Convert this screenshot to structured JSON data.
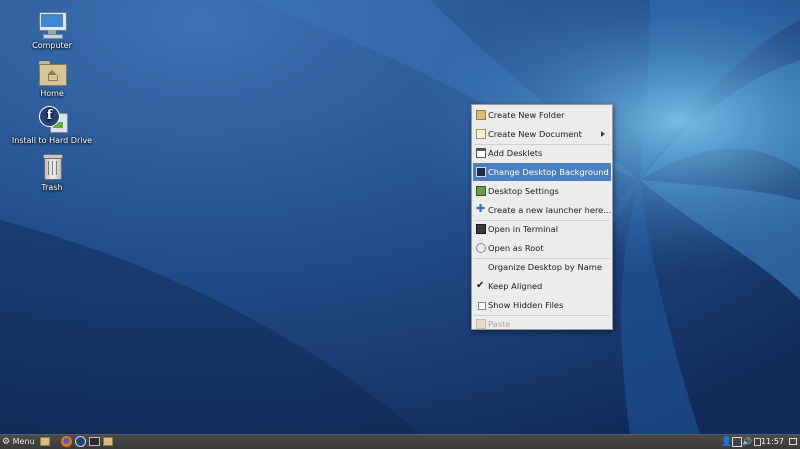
{
  "desktop": {
    "icons": [
      {
        "label": "Computer",
        "icon": "computer-icon"
      },
      {
        "label": "Home",
        "icon": "home-folder-icon"
      },
      {
        "label": "Install to Hard Drive",
        "icon": "fedora-install-icon"
      },
      {
        "label": "Trash",
        "icon": "trash-icon"
      }
    ]
  },
  "context_menu": {
    "items": [
      {
        "label": "Create New Folder",
        "icon": "folder-icon"
      },
      {
        "label": "Create New Document",
        "icon": "document-icon",
        "submenu": true
      },
      {
        "label": "Add Desklets",
        "icon": "desklet-icon"
      },
      {
        "label": "Change Desktop Background",
        "icon": "wallpaper-icon",
        "highlighted": true
      },
      {
        "label": "Desktop Settings",
        "icon": "settings-icon"
      },
      {
        "label": "Create a new launcher here...",
        "icon": "launcher-icon"
      },
      {
        "label": "Open in Terminal",
        "icon": "terminal-icon"
      },
      {
        "label": "Open as Root",
        "icon": "root-icon"
      },
      {
        "label": "Organize Desktop by Name",
        "icon": ""
      },
      {
        "label": "Keep Aligned",
        "icon": "checkmark-icon",
        "checked": true
      },
      {
        "label": "Show Hidden Files",
        "icon": "checkbox-icon",
        "checked": false
      },
      {
        "label": "Paste",
        "icon": "paste-icon",
        "disabled": true
      }
    ]
  },
  "panel": {
    "menu_label": "Menu",
    "clock": "11:57",
    "colors": {
      "panel": "#3f3f3f",
      "highlight": "#4a7fc0"
    }
  }
}
